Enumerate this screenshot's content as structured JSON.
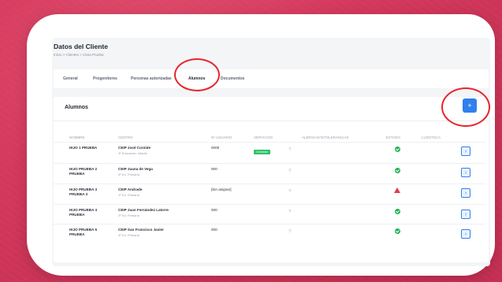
{
  "page": {
    "title": "Datos del Cliente",
    "breadcrumb": "Inicio > Clientes > Clara Prueba"
  },
  "tabs": [
    {
      "label": "General"
    },
    {
      "label": "Progenitores"
    },
    {
      "label": "Personas autorizadas"
    },
    {
      "label": "Alumnos",
      "active": true
    },
    {
      "label": "Documentos"
    }
  ],
  "panel": {
    "title": "Alumnos",
    "add_label": "+"
  },
  "table": {
    "headers": [
      "NOMBRE",
      "CENTRO",
      "Nº USUARIO",
      "SERVICIOS",
      "ALERGIAS/INTOLERANCIAS",
      "ESTADO",
      "LUDOTECA"
    ],
    "rows": [
      {
        "name": "HIJO 1 PRUEBA",
        "center": "CEIP José Cornide",
        "center_sub": "4º Educación Infantil",
        "user_no": "0000",
        "service": "Comedor",
        "allergy_icon": "grid-icon",
        "status": "ok"
      },
      {
        "name": "HIJO PRUEBA 2 PRUEBA",
        "center": "CEIP Juana de Vega",
        "center_sub": "3º Ed. Primaria",
        "user_no": "000",
        "service": "",
        "allergy_icon": "grid-icon",
        "status": "ok"
      },
      {
        "name": "HIJO PRUEBA 3 PRUEBA 3",
        "center": "CEIP Andrade",
        "center_sub": "1º Ed. Primaria",
        "user_no": "[Sin asignar]",
        "service": "",
        "allergy_icon": "grid-icon",
        "status": "warning"
      },
      {
        "name": "HIJO PRUEBA 4 PRUEBA",
        "center": "CEIP Juan Fernández Latorre",
        "center_sub": "2º Ed. Primaria",
        "user_no": "000",
        "service": "",
        "allergy_icon": "grid-icon",
        "status": "ok"
      },
      {
        "name": "HIJO PRUEBA 5 PRUEBA",
        "center": "CEIP San Francisco Javier",
        "center_sub": "3º Ed. Primaria",
        "user_no": "000",
        "service": "",
        "allergy_icon": "grid-icon",
        "status": "ok"
      }
    ],
    "row_action_icon": "chevron-right-icon",
    "row_action_label": "›"
  },
  "colors": {
    "accent": "#2f80ed",
    "highlight": "#e8262c",
    "status_ok": "#23b259",
    "status_warn": "#e63a46",
    "service_badge": "#2ec16a",
    "background": "#d63a5e"
  }
}
